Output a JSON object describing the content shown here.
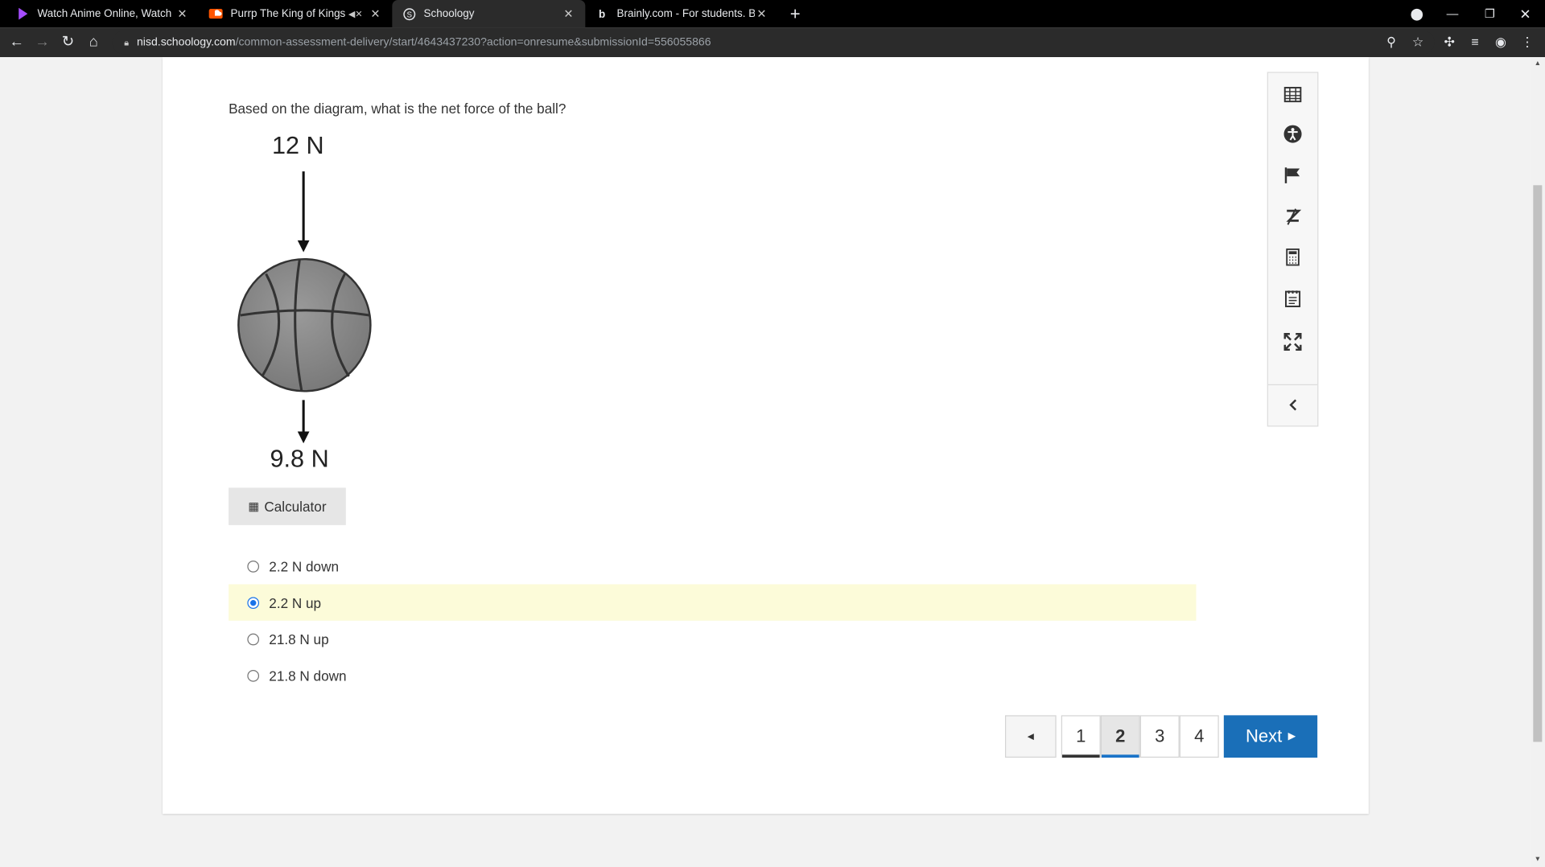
{
  "browser": {
    "tabs": [
      {
        "title": "Watch Anime Online, Watch English",
        "icon": "play-icon",
        "icon_color": "#a64dff"
      },
      {
        "title": "Purrp The King of Kings by SPN",
        "icon": "soundcloud-icon",
        "icon_color": "#ff5500"
      },
      {
        "title": "Schoology",
        "icon": "schoology-icon",
        "icon_color": "#ffffff"
      },
      {
        "title": "Brainly.com - For students. By students.",
        "icon": "brainly-icon",
        "icon_color": "#ffffff"
      }
    ],
    "url_host": "nisd.schoology.com",
    "url_path": "/common-assessment-delivery/start/4643437230?action=onresume&submissionId=556055866"
  },
  "question": {
    "text": "Based on the diagram, what is the net force of the ball?",
    "top_force": "12 N",
    "bottom_force": "9.8 N"
  },
  "calculator_label": "Calculator",
  "choices": [
    {
      "label": "2.2 N down",
      "selected": false
    },
    {
      "label": "2.2 N up",
      "selected": true
    },
    {
      "label": "21.8 N up",
      "selected": false
    },
    {
      "label": "21.8 N down",
      "selected": false
    }
  ],
  "tools": [
    "table-icon",
    "accessibility-icon",
    "flag-icon",
    "eraser-icon",
    "calculator-icon",
    "notepad-icon",
    "fullscreen-icon",
    "collapse-icon"
  ],
  "pager": {
    "prev": "◄",
    "pages": [
      "1",
      "2",
      "3",
      "4"
    ],
    "current": "2",
    "next_label": "Next",
    "next_arrow": "▶"
  },
  "colors": {
    "selected_bg": "#fcfbd9",
    "next_bg": "#1a6fb8",
    "radio_on": "#1a73e8"
  }
}
